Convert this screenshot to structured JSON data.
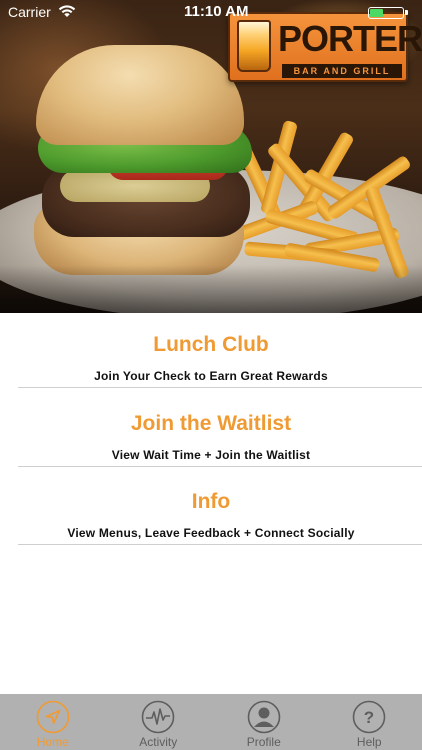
{
  "status_bar": {
    "carrier": "Carrier",
    "time": "11:10 AM",
    "battery_color": "#4cd964"
  },
  "hero": {
    "logo": {
      "name": "PORTERS",
      "tagline": "BAR AND GRILL",
      "icon": "beer-glass-icon"
    }
  },
  "menu": {
    "items": [
      {
        "title": "Lunch Club",
        "subtitle": "Join Your Check to Earn Great Rewards"
      },
      {
        "title": "Join the Waitlist",
        "subtitle": "View Wait Time + Join the Waitlist"
      },
      {
        "title": "Info",
        "subtitle": "View Menus, Leave Feedback + Connect Socially"
      }
    ]
  },
  "tab_bar": {
    "tabs": [
      {
        "label": "Home",
        "icon": "navigation-arrow-icon",
        "active": true
      },
      {
        "label": "Activity",
        "icon": "pulse-icon",
        "active": false
      },
      {
        "label": "Profile",
        "icon": "person-icon",
        "active": false
      },
      {
        "label": "Help",
        "icon": "question-mark-icon",
        "active": false
      }
    ]
  },
  "colors": {
    "accent": "#f09a33",
    "tab_bar_bg": "#b1b1b1",
    "tab_inactive": "#5e5e5e"
  }
}
